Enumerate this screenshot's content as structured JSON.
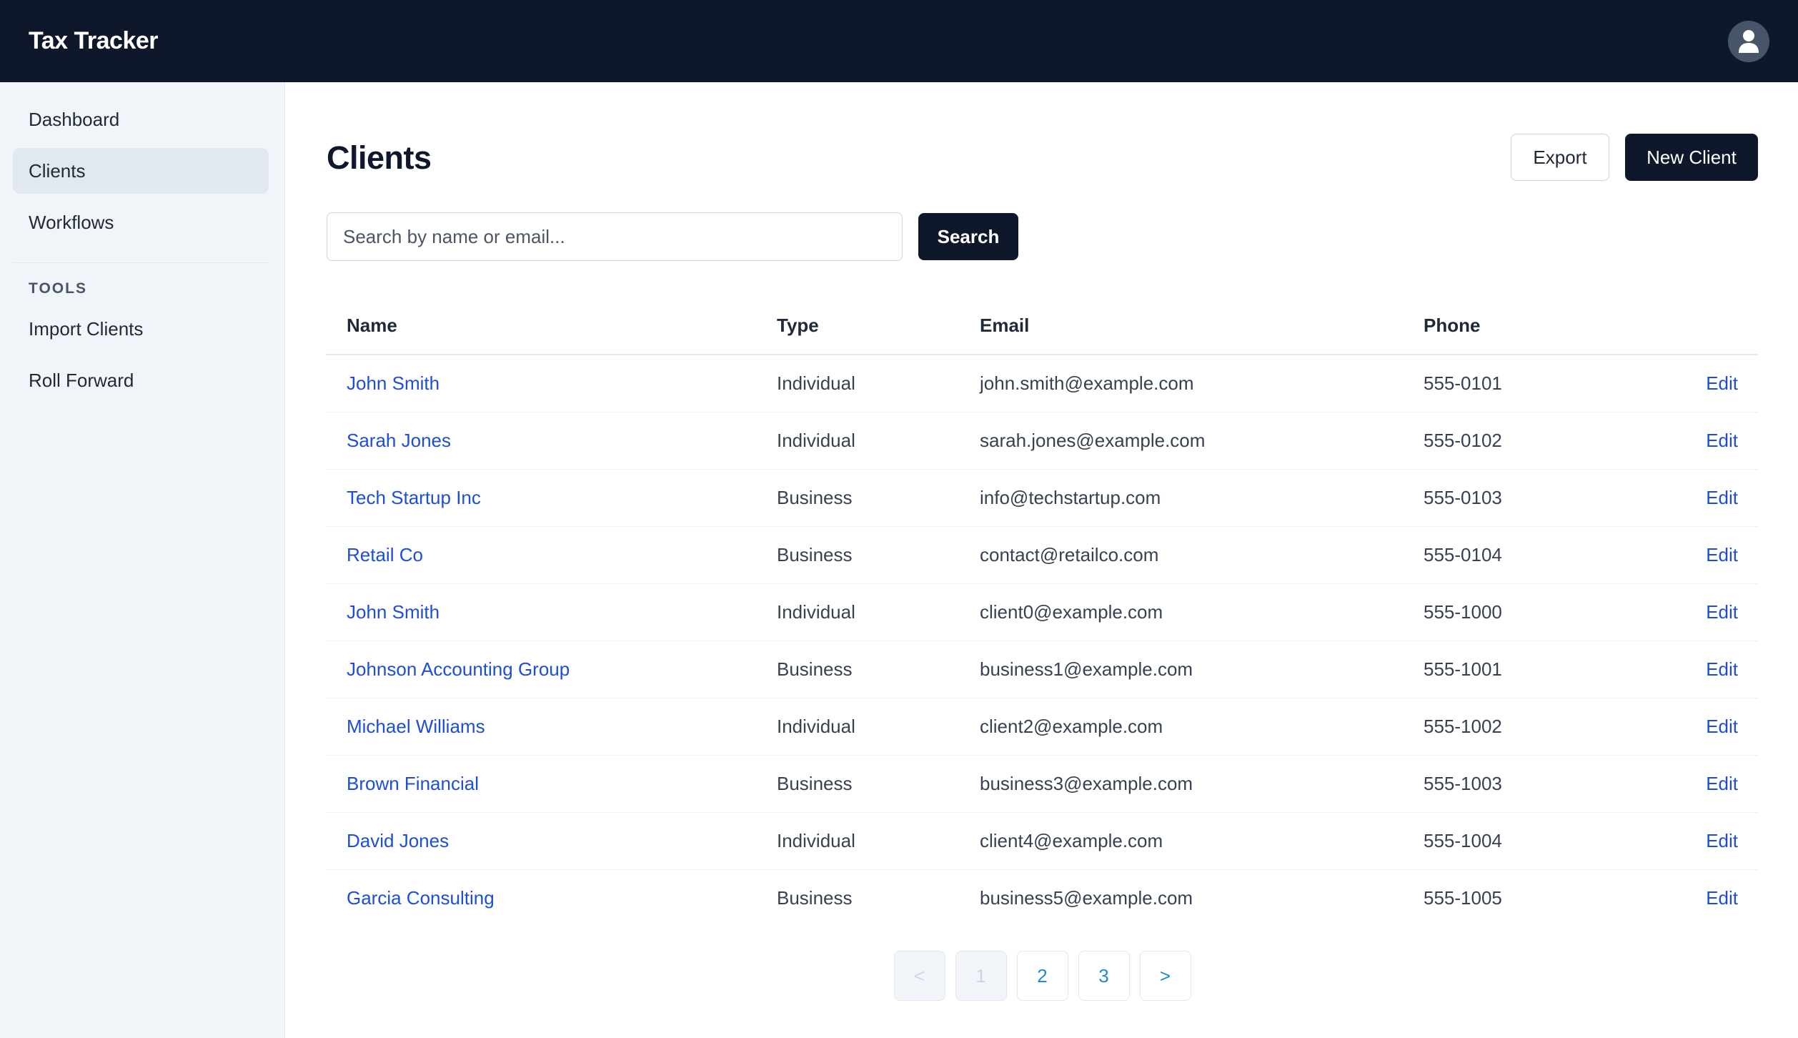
{
  "app": {
    "title": "Tax Tracker"
  },
  "sidebar": {
    "items": [
      {
        "label": "Dashboard"
      },
      {
        "label": "Clients"
      },
      {
        "label": "Workflows"
      }
    ],
    "tools_heading": "TOOLS",
    "tools": [
      {
        "label": "Import Clients"
      },
      {
        "label": "Roll Forward"
      }
    ]
  },
  "page": {
    "title": "Clients",
    "export_label": "Export",
    "new_client_label": "New Client"
  },
  "search": {
    "placeholder": "Search by name or email...",
    "value": "",
    "button_label": "Search"
  },
  "table": {
    "headers": {
      "name": "Name",
      "type": "Type",
      "email": "Email",
      "phone": "Phone"
    },
    "action_label": "Edit",
    "rows": [
      {
        "name": "John Smith",
        "type": "Individual",
        "email": "john.smith@example.com",
        "phone": "555-0101"
      },
      {
        "name": "Sarah Jones",
        "type": "Individual",
        "email": "sarah.jones@example.com",
        "phone": "555-0102"
      },
      {
        "name": "Tech Startup Inc",
        "type": "Business",
        "email": "info@techstartup.com",
        "phone": "555-0103"
      },
      {
        "name": "Retail Co",
        "type": "Business",
        "email": "contact@retailco.com",
        "phone": "555-0104"
      },
      {
        "name": "John Smith",
        "type": "Individual",
        "email": "client0@example.com",
        "phone": "555-1000"
      },
      {
        "name": "Johnson Accounting Group",
        "type": "Business",
        "email": "business1@example.com",
        "phone": "555-1001"
      },
      {
        "name": "Michael Williams",
        "type": "Individual",
        "email": "client2@example.com",
        "phone": "555-1002"
      },
      {
        "name": "Brown Financial",
        "type": "Business",
        "email": "business3@example.com",
        "phone": "555-1003"
      },
      {
        "name": "David Jones",
        "type": "Individual",
        "email": "client4@example.com",
        "phone": "555-1004"
      },
      {
        "name": "Garcia Consulting",
        "type": "Business",
        "email": "business5@example.com",
        "phone": "555-1005"
      }
    ]
  },
  "pagination": {
    "prev_label": "<",
    "pages": [
      "1",
      "2",
      "3"
    ],
    "next_label": ">"
  },
  "colors": {
    "topbar": "#0f172a",
    "link": "#1d4ed8",
    "sidebar_bg": "#f1f5f9"
  },
  "icons": {
    "user": "user-icon"
  }
}
